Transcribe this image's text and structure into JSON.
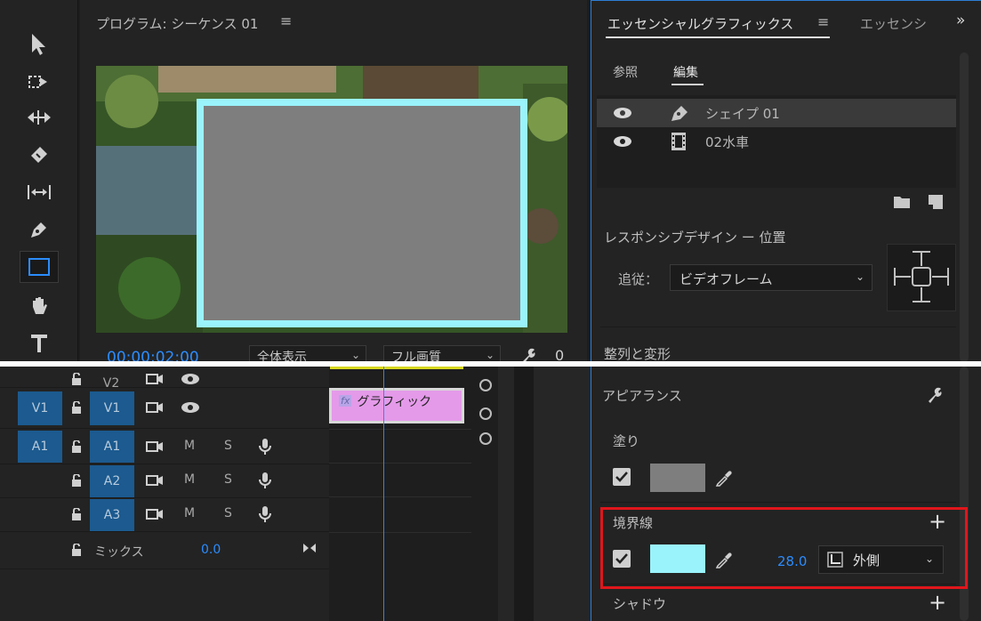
{
  "program_monitor": {
    "title": "プログラム: シーケンス 01",
    "menu_icon": "hamburger-menu-icon",
    "timecode": "00:00:02:00",
    "zoom_select": "全体表示",
    "quality_select": "フル画質",
    "counter": "0"
  },
  "tools": [
    "selection-tool",
    "track-select-tool",
    "ripple-edit-tool",
    "razor-tool",
    "slip-tool",
    "pen-tool",
    "rectangle-tool",
    "hand-tool",
    "type-tool"
  ],
  "essential_graphics": {
    "tab_active": "エッセンシャルグラフィックス",
    "tab_inactive": "エッセンシ",
    "more_icon": "chevron-double-right-icon",
    "subtab_browse": "参照",
    "subtab_edit": "編集",
    "layers": [
      {
        "name": "シェイプ 01",
        "icon": "pen-icon",
        "selected": true
      },
      {
        "name": "02水車",
        "icon": "film-icon",
        "selected": false
      }
    ],
    "responsive_title": "レスポンシブデザイン ー 位置",
    "follow_label": "追従：",
    "follow_value": "ビデオフレーム",
    "align_title": "整列と変形",
    "appearance_title": "アピアランス",
    "fill_label": "塗り",
    "fill_color": "#7e7e7e",
    "stroke_label": "境界線",
    "stroke_color": "#9af3fb",
    "stroke_width": "28.0",
    "stroke_position": "外側",
    "shadow_label": "シャドウ",
    "highlight_color": "#e0161b",
    "accent_color": "#2b8cff"
  },
  "timeline": {
    "tracks": [
      {
        "patch": "",
        "name": "V2",
        "type": "video"
      },
      {
        "patch": "V1",
        "name": "V1",
        "type": "video"
      },
      {
        "patch": "A1",
        "name": "A1",
        "type": "audio",
        "m": "M",
        "s": "S"
      },
      {
        "patch": "",
        "name": "A2",
        "type": "audio",
        "m": "M",
        "s": "S"
      },
      {
        "patch": "",
        "name": "A3",
        "type": "audio",
        "m": "M",
        "s": "S"
      }
    ],
    "mix_label": "ミックス",
    "mix_value": "0.0",
    "clip_label": "グラフィック",
    "clip_fx": "fx"
  }
}
